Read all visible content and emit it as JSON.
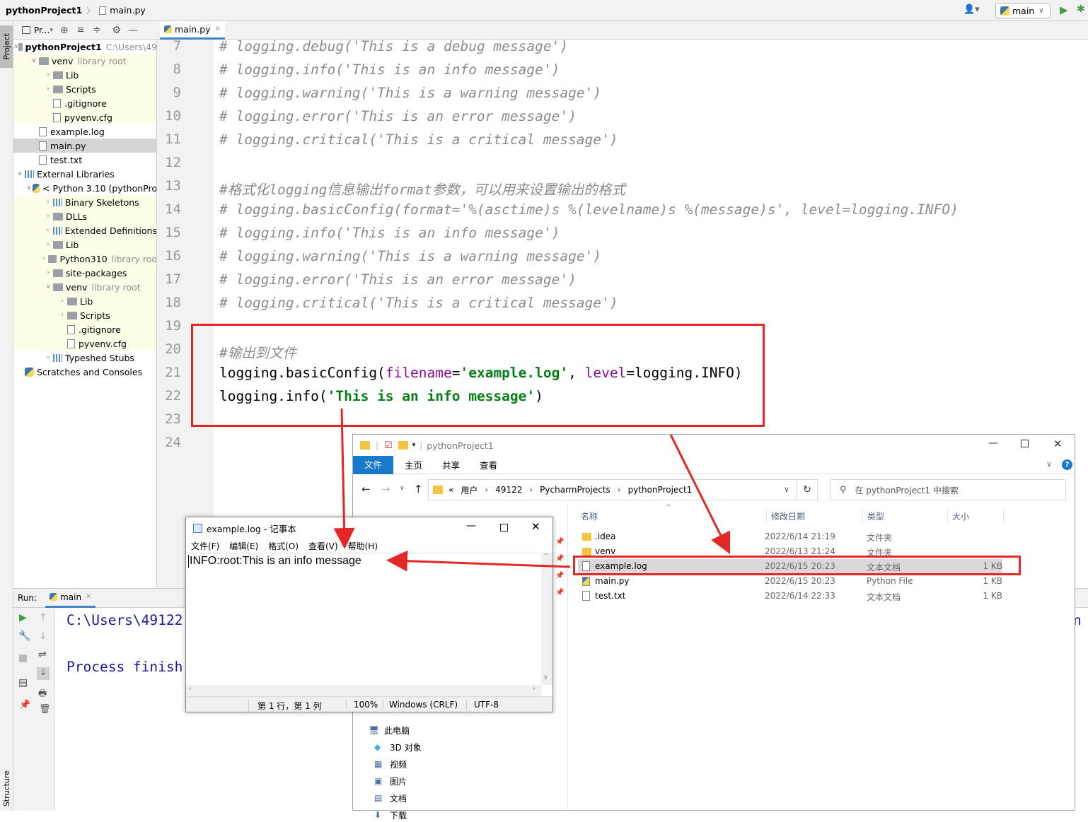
{
  "nav": {
    "project": "pythonProject1",
    "file": "main.py",
    "branch": "main"
  },
  "sidebar": {
    "project_tab": "Project",
    "structure_tab": "Structure",
    "toolbar_label": "Pr..."
  },
  "tree": [
    {
      "label": "pythonProject1",
      "suffix": "C:\\Users\\49",
      "indent": 0,
      "icon": "folder-icon",
      "arrow": "down",
      "bold": true,
      "y": false
    },
    {
      "label": "venv",
      "suffix": "library root",
      "indent": 1,
      "icon": "folder-icon",
      "arrow": "down",
      "y": true
    },
    {
      "label": "Lib",
      "indent": 2,
      "icon": "folder-icon",
      "arrow": "right",
      "y": true
    },
    {
      "label": "Scripts",
      "indent": 2,
      "icon": "folder-icon",
      "arrow": "right",
      "y": true
    },
    {
      "label": ".gitignore",
      "indent": 2,
      "icon": "file-icon",
      "arrow": "",
      "y": true
    },
    {
      "label": "pyvenv.cfg",
      "indent": 2,
      "icon": "file-icon",
      "arrow": "",
      "y": true
    },
    {
      "label": "example.log",
      "indent": 1,
      "icon": "file-icon",
      "arrow": "",
      "y": false
    },
    {
      "label": "main.py",
      "indent": 1,
      "icon": "file-icon",
      "arrow": "",
      "sel": true
    },
    {
      "label": "test.txt",
      "indent": 1,
      "icon": "file-icon",
      "arrow": "",
      "y": false
    },
    {
      "label": "External Libraries",
      "indent": 0,
      "icon": "library-icon",
      "arrow": "down",
      "y": false
    },
    {
      "label": "< Python 3.10 (pythonPro",
      "indent": 1,
      "icon": "python-icon",
      "arrow": "down",
      "y": false
    },
    {
      "label": "Binary Skeletons",
      "indent": 2,
      "icon": "library-icon",
      "arrow": "right",
      "y": true
    },
    {
      "label": "DLLs",
      "indent": 2,
      "icon": "folder-icon",
      "arrow": "right",
      "y": true
    },
    {
      "label": "Extended Definitions",
      "indent": 2,
      "icon": "library-icon",
      "arrow": "right",
      "y": true
    },
    {
      "label": "Lib",
      "indent": 2,
      "icon": "folder-icon",
      "arrow": "right",
      "y": true
    },
    {
      "label": "Python310",
      "suffix": "library roo",
      "indent": 2,
      "icon": "folder-icon",
      "arrow": "right",
      "y": true
    },
    {
      "label": "site-packages",
      "indent": 2,
      "icon": "folder-icon",
      "arrow": "right",
      "y": true
    },
    {
      "label": "venv",
      "suffix": "library root",
      "indent": 2,
      "icon": "folder-icon",
      "arrow": "down",
      "y": true
    },
    {
      "label": "Lib",
      "indent": 3,
      "icon": "folder-icon",
      "arrow": "right",
      "y": true
    },
    {
      "label": "Scripts",
      "indent": 3,
      "icon": "folder-icon",
      "arrow": "right",
      "y": true
    },
    {
      "label": ".gitignore",
      "indent": 3,
      "icon": "file-icon",
      "arrow": "",
      "y": true
    },
    {
      "label": "pyvenv.cfg",
      "indent": 3,
      "icon": "file-icon",
      "arrow": "",
      "y": true
    },
    {
      "label": "Typeshed Stubs",
      "indent": 2,
      "icon": "library-icon",
      "arrow": "right",
      "y": false
    },
    {
      "label": "Scratches and Consoles",
      "indent": 0,
      "icon": "scratch-icon",
      "arrow": "",
      "y": false
    }
  ],
  "editor": {
    "tab": "main.py",
    "lines": [
      {
        "n": "7",
        "text": "# logging.debug('This is a debug message')",
        "kind": "comment"
      },
      {
        "n": "8",
        "text": "# logging.info('This is an info message')",
        "kind": "comment"
      },
      {
        "n": "9",
        "text": "# logging.warning('This is a warning message')",
        "kind": "comment"
      },
      {
        "n": "10",
        "text": "# logging.error('This is an error message')",
        "kind": "comment"
      },
      {
        "n": "11",
        "text": "# logging.critical('This is a critical message')",
        "kind": "comment"
      },
      {
        "n": "12",
        "text": "",
        "kind": "comment"
      },
      {
        "n": "13",
        "text": "#格式化logging信息输出format参数，可以用来设置输出的格式",
        "kind": "comment"
      },
      {
        "n": "14",
        "text": "# logging.basicConfig(format='%(asctime)s %(levelname)s %(message)s', level=logging.INFO)",
        "kind": "comment"
      },
      {
        "n": "15",
        "text": "# logging.info('This is an info message')",
        "kind": "comment"
      },
      {
        "n": "16",
        "text": "# logging.warning('This is a warning message')",
        "kind": "comment"
      },
      {
        "n": "17",
        "text": "# logging.error('This is an error message')",
        "kind": "comment"
      },
      {
        "n": "18",
        "text": "# logging.critical('This is a critical message')",
        "kind": "comment"
      },
      {
        "n": "19",
        "text": "",
        "kind": "comment"
      },
      {
        "n": "20",
        "text": "#输出到文件",
        "kind": "comment"
      },
      {
        "n": "21",
        "kind": "code21"
      },
      {
        "n": "22",
        "kind": "code22"
      },
      {
        "n": "23",
        "text": "",
        "kind": "comment"
      },
      {
        "n": "24",
        "text": "",
        "kind": "comment"
      }
    ],
    "code21": {
      "a": "logging.basicConfig(",
      "b": "filename",
      "c": "=",
      "d": "'example.log'",
      "e": ", ",
      "f": "level",
      "g": "=logging.INFO)"
    },
    "code22": {
      "a": "logging.info(",
      "b": "'This is an info message'",
      "c": ")"
    }
  },
  "run": {
    "label": "Run:",
    "tab": "main",
    "line1": "C:\\Users\\49122",
    "line2": "Process finish",
    "tail": "n"
  },
  "explorer": {
    "title": "pythonProject1",
    "ribbon": [
      "文件",
      "主页",
      "共享",
      "查看"
    ],
    "path": [
      "«",
      "用户",
      "49122",
      "PycharmProjects",
      "pythonProject1"
    ],
    "search_placeholder": "在 pythonProject1 中搜索",
    "columns": [
      "名称",
      "修改日期",
      "类型",
      "大小"
    ],
    "files": [
      {
        "name": ".idea",
        "date": "2022/6/14 21:19",
        "type": "文件夹",
        "size": "",
        "icon": "folder"
      },
      {
        "name": "venv",
        "date": "2022/6/13 21:24",
        "type": "文件夹",
        "size": "",
        "icon": "folder"
      },
      {
        "name": "example.log",
        "date": "2022/6/15 20:23",
        "type": "文本文档",
        "size": "1 KB",
        "icon": "file",
        "sel": true
      },
      {
        "name": "main.py",
        "date": "2022/6/15 20:23",
        "type": "Python File",
        "size": "1 KB",
        "icon": "py"
      },
      {
        "name": "test.txt",
        "date": "2022/6/14 22:33",
        "type": "文本文档",
        "size": "1 KB",
        "icon": "file"
      }
    ],
    "nav_tree": [
      "此电脑",
      "3D 对象",
      "视频",
      "图片",
      "文档",
      "下载"
    ]
  },
  "notepad": {
    "title": "example.log - 记事本",
    "menu": [
      "文件(F)",
      "编辑(E)",
      "格式(O)",
      "查看(V)",
      "帮助(H)"
    ],
    "content": "INFO:root:This is an info message",
    "status": [
      "第 1 行，第 1 列",
      "100%",
      "Windows (CRLF)",
      "UTF-8"
    ]
  },
  "colors": {
    "accent": "#e32626",
    "ribbon": "#1979ca",
    "string": "#067d17",
    "keyword": "#871094"
  }
}
